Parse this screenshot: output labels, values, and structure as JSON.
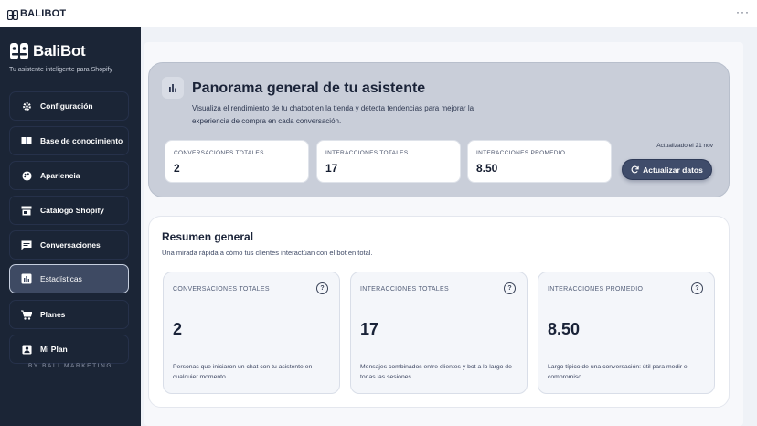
{
  "window": {
    "title": "BALIBOT",
    "more_label": "···"
  },
  "sidebar": {
    "brand": "BaliBot",
    "tagline": "Tu asistente inteligente para Shopify",
    "items": [
      {
        "label": "Configuración",
        "icon": "gear-icon",
        "active": false
      },
      {
        "label": "Base de conocimiento",
        "icon": "book-icon",
        "active": false
      },
      {
        "label": "Apariencia",
        "icon": "palette-icon",
        "active": false
      },
      {
        "label": "Catálogo Shopify",
        "icon": "store-icon",
        "active": false
      },
      {
        "label": "Conversaciones",
        "icon": "chat-icon",
        "active": false
      },
      {
        "label": "Estadísticas",
        "icon": "bar-chart-icon",
        "active": true
      },
      {
        "label": "Planes",
        "icon": "cart-icon",
        "active": false
      },
      {
        "label": "Mi Plan",
        "icon": "user-icon",
        "active": false
      }
    ],
    "footer": "BY BALI MARKETING"
  },
  "hero": {
    "title": "Panorama general de tu asistente",
    "description": "Visualiza el rendimiento de tu chatbot en la tienda y detecta tendencias para mejorar la experiencia de compra en cada conversación.",
    "stats": [
      {
        "label": "CONVERSACIONES TOTALES",
        "value": "2"
      },
      {
        "label": "INTERACCIONES TOTALES",
        "value": "17"
      },
      {
        "label": "INTERACCIONES PROMEDIO",
        "value": "8.50"
      }
    ],
    "updated": "Actualizado el 21 nov",
    "refresh_label": "Actualizar datos"
  },
  "summary": {
    "title": "Resumen general",
    "subtitle": "Una mirada rápida a cómo tus clientes interactúan con el bot en total.",
    "cards": [
      {
        "label": "CONVERSACIONES TOTALES",
        "value": "2",
        "description": "Personas que iniciaron un chat con tu asistente en cualquier momento.",
        "help": "?"
      },
      {
        "label": "INTERACCIONES TOTALES",
        "value": "17",
        "description": "Mensajes combinados entre clientes y bot a lo largo de todas las sesiones.",
        "help": "?"
      },
      {
        "label": "INTERACCIONES PROMEDIO",
        "value": "8.50",
        "description": "Largo típico de una conversación: útil para medir el compromiso.",
        "help": "?"
      }
    ]
  },
  "colors": {
    "sidebar_bg": "#1b2536",
    "accent": "#3f4c6a",
    "hero_bg": "#c9ced9"
  }
}
